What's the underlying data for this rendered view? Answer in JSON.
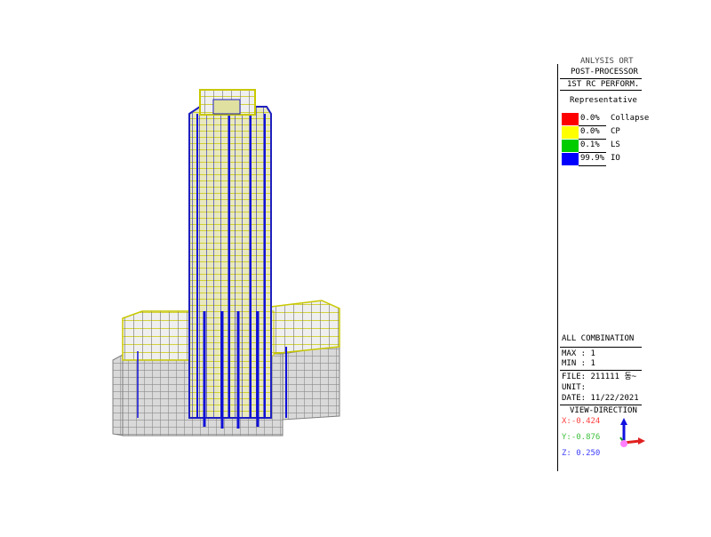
{
  "panel": {
    "header_partial": "ANLYSIS ORT",
    "post_processor": "POST-PROCESSOR",
    "mode": "1ST RC PERFORM.",
    "representative": "Representative"
  },
  "legend": [
    {
      "pct": "0.0%",
      "label": "Collapse",
      "color": "#ff0000"
    },
    {
      "pct": "0.0%",
      "label": "CP",
      "color": "#ffff00"
    },
    {
      "pct": "0.1%",
      "label": "LS",
      "color": "#00cc00"
    },
    {
      "pct": "99.9%",
      "label": "IO",
      "color": "#0000ff"
    }
  ],
  "info": {
    "combination": "ALL COMBINATION",
    "max": "MAX : 1",
    "min": "MIN : 1",
    "file": "FILE: 211111 동~",
    "unit": "UNIT:",
    "date": "DATE: 11/22/2021",
    "view_direction": "VIEW-DIRECTION",
    "x": "X:-0.424",
    "y": "Y:-0.876",
    "z": "Z: 0.250"
  },
  "colors": {
    "beam_yellow": "#c8c800",
    "column_blue": "#1010d8",
    "frame_gray": "#9a9a9a",
    "x_axis": "#ff4040",
    "y_axis": "#40c040",
    "z_axis": "#4040ff"
  }
}
